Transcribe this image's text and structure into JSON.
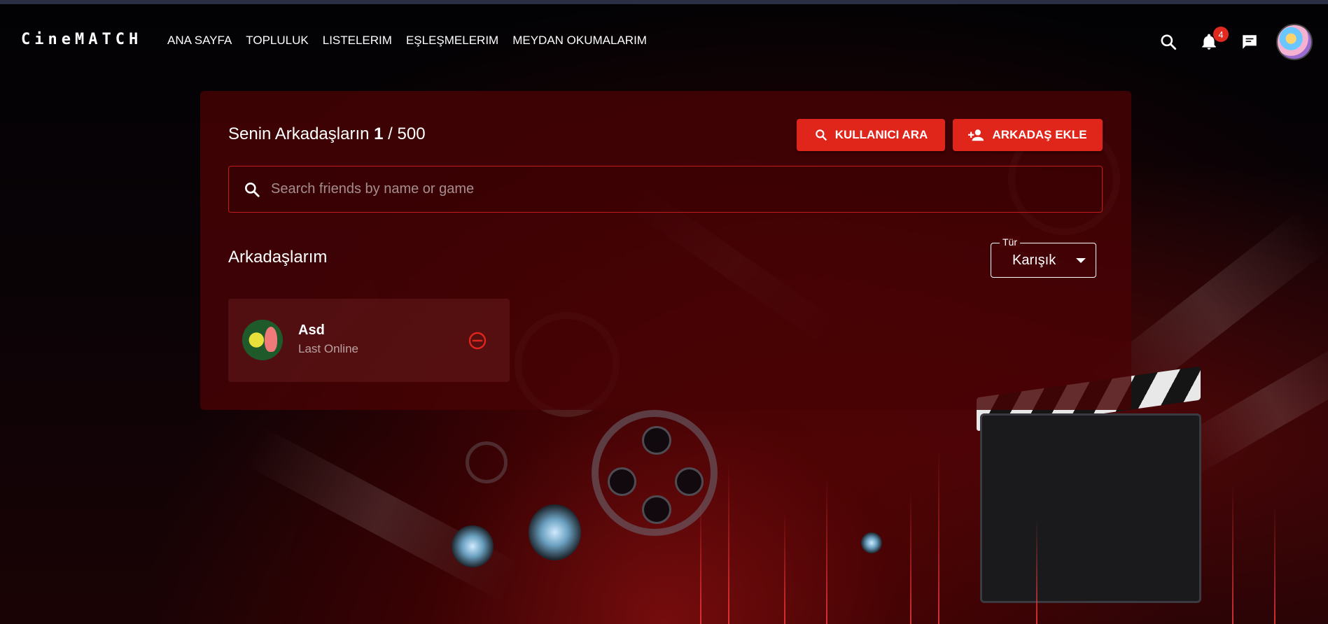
{
  "brand": "CineMATCH",
  "nav": {
    "links": [
      "ANA SAYFA",
      "TOPLULUK",
      "LISTELERIM",
      "EŞLEŞMELERIM",
      "MEYDAN OKUMALARIM"
    ],
    "notification_count": "4",
    "icons": [
      "search-icon",
      "bell-icon",
      "chat-icon"
    ]
  },
  "friends": {
    "title_prefix": "Senin Arkadaşların",
    "count": "1",
    "separator": " / ",
    "limit": "500",
    "search_user_label": "KULLANICI ARA",
    "add_friend_label": "ARKADAŞ EKLE",
    "search_placeholder": "Search friends by name or game",
    "section_title": "Arkadaşlarım",
    "sort": {
      "label": "Tür",
      "value": "Karışık"
    },
    "list": [
      {
        "name": "Asd",
        "status": "Last Online"
      }
    ]
  },
  "colors": {
    "accent": "#e0251b",
    "card_bg": "#480305",
    "badge": "#e02a1f"
  }
}
